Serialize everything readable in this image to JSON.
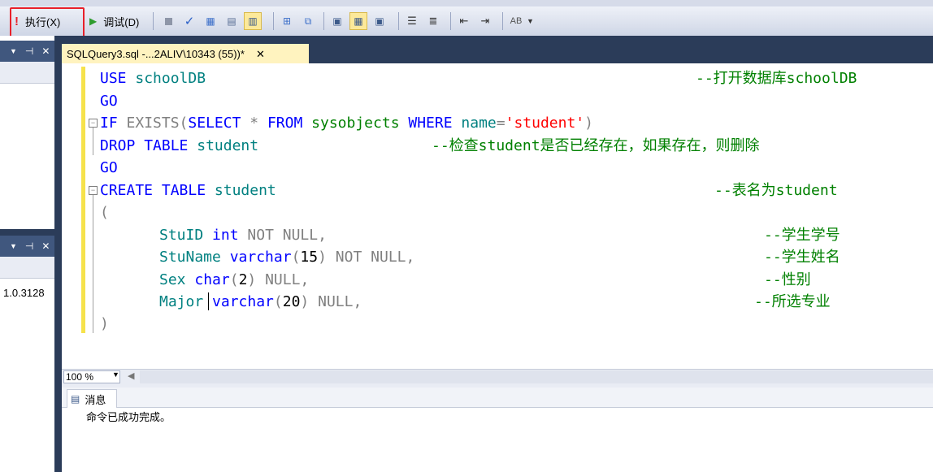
{
  "toolbar": {
    "execute_label": "执行(X)",
    "debug_label": "调试(D)"
  },
  "left_panel": {
    "version_text": "1.0.3128",
    "panel_icons": [
      "▼",
      "⊣",
      "✕"
    ]
  },
  "document_tab": {
    "title": "SQLQuery3.sql -...2ALIV\\10343 (55))*",
    "close_glyph": "✕"
  },
  "editor": {
    "lines": [
      {
        "code": "USE schoolDB",
        "comment": "--打开数据库schoolDB"
      },
      {
        "code": "GO",
        "comment": ""
      },
      {
        "code": "IF EXISTS(SELECT * FROM sysobjects WHERE name='student')",
        "comment": ""
      },
      {
        "code": "DROP TABLE student",
        "comment": "--检查student是否已经存在，如果存在，则删除"
      },
      {
        "code": "GO",
        "comment": ""
      },
      {
        "code": "CREATE TABLE student",
        "comment": "--表名为student"
      },
      {
        "code": "(",
        "comment": ""
      },
      {
        "code": "StuID int NOT NULL,",
        "comment": "--学生学号"
      },
      {
        "code": "StuName varchar(15) NOT NULL,",
        "comment": "--学生姓名"
      },
      {
        "code": "Sex char(2) NULL,",
        "comment": "--性别"
      },
      {
        "code": "Major varchar(20) NULL,",
        "comment": "--所选专业"
      },
      {
        "code": ")",
        "comment": ""
      }
    ]
  },
  "zoom": {
    "value": "100 %"
  },
  "messages": {
    "tab_label": "消息",
    "text": "命令已成功完成。"
  },
  "colors": {
    "keyword": "#0000ff",
    "gray_keyword": "#808080",
    "identifier": "#008080",
    "string": "#ff0000",
    "comment": "#008000",
    "highlight": "#e8202a"
  }
}
